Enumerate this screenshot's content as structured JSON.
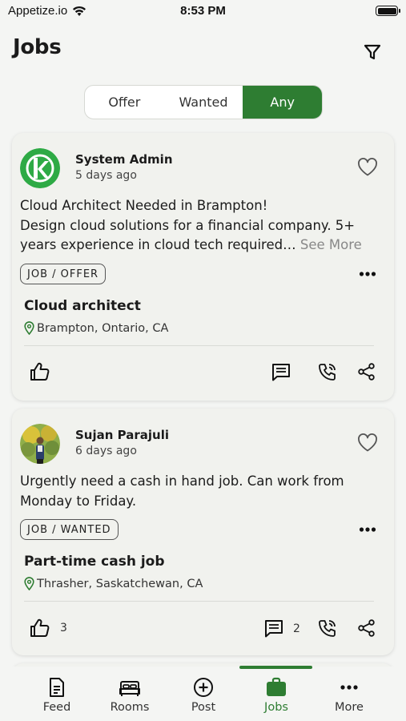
{
  "status_bar": {
    "carrier": "Appetize.io",
    "time": "8:53 PM"
  },
  "header": {
    "title": "Jobs"
  },
  "segments": [
    {
      "label": "Offer",
      "active": false
    },
    {
      "label": "Wanted",
      "active": false
    },
    {
      "label": "Any",
      "active": true
    }
  ],
  "posts": [
    {
      "author": "System Admin",
      "time_ago": "5 days ago",
      "text_line1": "Cloud Architect Needed in Brampton!",
      "text_line2": "Design cloud solutions for a financial company. 5+ years experience in cloud tech required…",
      "see_more": "See More",
      "tag": "JOB / OFFER",
      "job_title": "Cloud architect",
      "location": "Brampton, Ontario, CA"
    },
    {
      "author": "Sujan Parajuli",
      "time_ago": "6 days ago",
      "text": "Urgently need a cash in hand job. Can work from Monday to Friday.",
      "tag": "JOB / WANTED",
      "job_title": "Part-time cash job",
      "location": "Thrasher, Saskatchewan, CA",
      "like_count": "3",
      "comment_count": "2"
    }
  ],
  "nav": [
    {
      "label": "Feed",
      "icon": "feed-icon"
    },
    {
      "label": "Rooms",
      "icon": "bed-icon"
    },
    {
      "label": "Post",
      "icon": "plus-circle-icon"
    },
    {
      "label": "Jobs",
      "icon": "briefcase-icon",
      "active": true
    },
    {
      "label": "More",
      "icon": "more-icon"
    }
  ],
  "colors": {
    "accent": "#2e7d32",
    "background": "#f4f5f3",
    "card": "#f1f2ee"
  }
}
